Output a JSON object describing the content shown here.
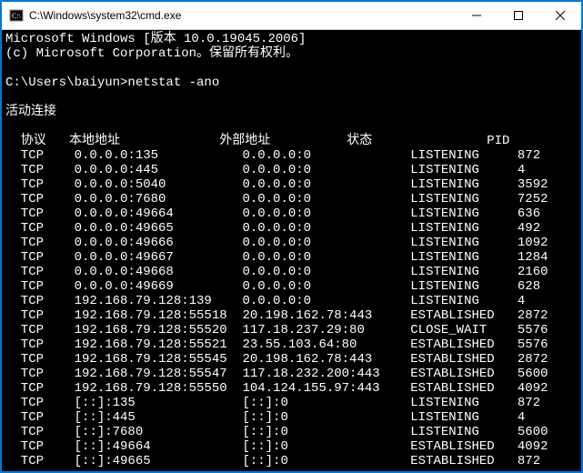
{
  "window": {
    "title": "C:\\Windows\\system32\\cmd.exe"
  },
  "banner": {
    "line1": "Microsoft Windows [版本 10.0.19045.2006]",
    "line2": "(c) Microsoft Corporation。保留所有权利。"
  },
  "prompt": {
    "path": "C:\\Users\\baiyun>",
    "command": "netstat -ano"
  },
  "section_title": "活动连接",
  "headers": {
    "proto": "协议",
    "local": "本地地址",
    "foreign": "外部地址",
    "state": "状态",
    "pid": "PID"
  },
  "rows": [
    {
      "proto": "TCP",
      "local": "0.0.0.0:135",
      "foreign": "0.0.0.0:0",
      "state": "LISTENING",
      "pid": "872"
    },
    {
      "proto": "TCP",
      "local": "0.0.0.0:445",
      "foreign": "0.0.0.0:0",
      "state": "LISTENING",
      "pid": "4"
    },
    {
      "proto": "TCP",
      "local": "0.0.0.0:5040",
      "foreign": "0.0.0.0:0",
      "state": "LISTENING",
      "pid": "3592"
    },
    {
      "proto": "TCP",
      "local": "0.0.0.0:7680",
      "foreign": "0.0.0.0:0",
      "state": "LISTENING",
      "pid": "7252"
    },
    {
      "proto": "TCP",
      "local": "0.0.0.0:49664",
      "foreign": "0.0.0.0:0",
      "state": "LISTENING",
      "pid": "636"
    },
    {
      "proto": "TCP",
      "local": "0.0.0.0:49665",
      "foreign": "0.0.0.0:0",
      "state": "LISTENING",
      "pid": "492"
    },
    {
      "proto": "TCP",
      "local": "0.0.0.0:49666",
      "foreign": "0.0.0.0:0",
      "state": "LISTENING",
      "pid": "1092"
    },
    {
      "proto": "TCP",
      "local": "0.0.0.0:49667",
      "foreign": "0.0.0.0:0",
      "state": "LISTENING",
      "pid": "1284"
    },
    {
      "proto": "TCP",
      "local": "0.0.0.0:49668",
      "foreign": "0.0.0.0:0",
      "state": "LISTENING",
      "pid": "2160"
    },
    {
      "proto": "TCP",
      "local": "0.0.0.0:49669",
      "foreign": "0.0.0.0:0",
      "state": "LISTENING",
      "pid": "628"
    },
    {
      "proto": "TCP",
      "local": "192.168.79.128:139",
      "foreign": "0.0.0.0:0",
      "state": "LISTENING",
      "pid": "4"
    },
    {
      "proto": "TCP",
      "local": "192.168.79.128:55518",
      "foreign": "20.198.162.78:443",
      "state": "ESTABLISHED",
      "pid": "2872"
    },
    {
      "proto": "TCP",
      "local": "192.168.79.128:55520",
      "foreign": "117.18.237.29:80",
      "state": "CLOSE_WAIT",
      "pid": "5576"
    },
    {
      "proto": "TCP",
      "local": "192.168.79.128:55521",
      "foreign": "23.55.103.64:80",
      "state": "ESTABLISHED",
      "pid": "5576"
    },
    {
      "proto": "TCP",
      "local": "192.168.79.128:55545",
      "foreign": "20.198.162.78:443",
      "state": "ESTABLISHED",
      "pid": "2872"
    },
    {
      "proto": "TCP",
      "local": "192.168.79.128:55547",
      "foreign": "117.18.232.200:443",
      "state": "ESTABLISHED",
      "pid": "5600"
    },
    {
      "proto": "TCP",
      "local": "192.168.79.128:55550",
      "foreign": "104.124.155.97:443",
      "state": "ESTABLISHED",
      "pid": "4092"
    },
    {
      "proto": "TCP",
      "local": "[::]:135",
      "foreign": "[::]:0",
      "state": "LISTENING",
      "pid": "872"
    },
    {
      "proto": "TCP",
      "local": "[::]:445",
      "foreign": "[::]:0",
      "state": "LISTENING",
      "pid": "4"
    },
    {
      "proto": "TCP",
      "local": "[::]:7680",
      "foreign": "[::]:0",
      "state": "LISTENING",
      "pid": "5600"
    },
    {
      "proto": "TCP",
      "local": "[::]:49664",
      "foreign": "[::]:0",
      "state": "ESTABLISHED",
      "pid": "4092"
    },
    {
      "proto": "TCP",
      "local": "[::]:49665",
      "foreign": "[::]:0",
      "state": "ESTABLISHED",
      "pid": "872"
    }
  ]
}
